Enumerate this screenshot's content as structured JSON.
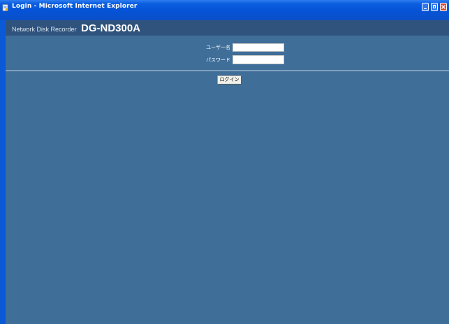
{
  "window": {
    "title": "Login - Microsoft Internet Explorer",
    "colors": {
      "titlebar": "#0553d6",
      "close_button": "#d9462a"
    }
  },
  "header": {
    "brand_text": "Network Disk Recorder",
    "model": "DG-ND300A",
    "colors": {
      "band": "#2f537c",
      "page_background": "#3f6e99"
    }
  },
  "login_form": {
    "username_label": "ユーザー名",
    "username_value": "",
    "password_label": "パスワード",
    "password_value": "",
    "submit_label": "ログイン"
  }
}
